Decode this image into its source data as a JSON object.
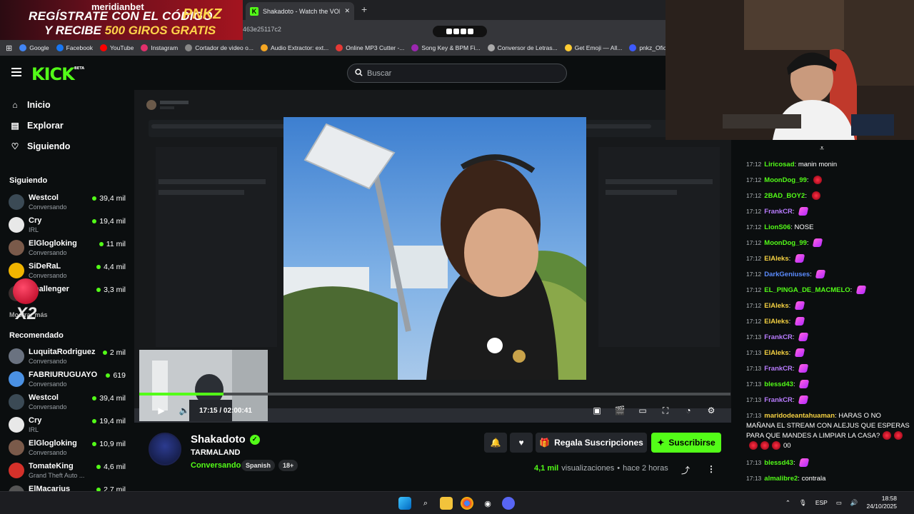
{
  "promo": {
    "brand": "meridianbet",
    "line1": "REGÍSTRATE CON EL CÓDIGO",
    "code": "PNKZ",
    "line2_prefix": "Y RECIBE ",
    "line2_highlight": "500 GIROS GRATIS"
  },
  "browser": {
    "tab_title": "Shakadoto - Watch the VOD on",
    "url_fragment": "463e25117c2",
    "bookmarks": [
      {
        "label": "Google",
        "color": "#4285f4"
      },
      {
        "label": "Facebook",
        "color": "#1877f2"
      },
      {
        "label": "YouTube",
        "color": "#ff0000"
      },
      {
        "label": "Instagram",
        "color": "#e1306c"
      },
      {
        "label": "Cortador de video o...",
        "color": "#888888"
      },
      {
        "label": "Audio Extractor: ext...",
        "color": "#f5a623"
      },
      {
        "label": "Online MP3 Cutter -...",
        "color": "#e53935"
      },
      {
        "label": "Song Key & BPM Fi...",
        "color": "#9c27b0"
      },
      {
        "label": "Conversor de Letras...",
        "color": "#aaaaaa"
      },
      {
        "label": "Get Emoji — All...",
        "color": "#ffcc33"
      },
      {
        "label": "pnkz_Ofic",
        "color": "#3d5afe"
      }
    ]
  },
  "kick": {
    "logo": "KICK",
    "logo_badge": "BETA",
    "search_placeholder": "Buscar"
  },
  "sidebar": {
    "nav": [
      "Inicio",
      "Explorar",
      "Siguiendo"
    ],
    "following_title": "Siguiendo",
    "following": [
      {
        "name": "Westcol",
        "sub": "Conversando",
        "viewers": "39,4 mil",
        "color": "#3b4a55"
      },
      {
        "name": "Cry",
        "sub": "IRL",
        "viewers": "19,4 mil",
        "color": "#e8e8e8"
      },
      {
        "name": "ElGlogloking",
        "sub": "Conversando",
        "viewers": "11 mil",
        "color": "#7a5a4a"
      },
      {
        "name": "SiDeRaL",
        "sub": "Conversando",
        "viewers": "4,4 mil",
        "color": "#f0b400"
      },
      {
        "name": "Challenger",
        "sub": "",
        "viewers": "3,3 mil",
        "color": "#3a2e2e"
      }
    ],
    "show_more": "Mostrar más",
    "recommended_title": "Recomendado",
    "recommended": [
      {
        "name": "LuquitaRodriguez",
        "sub": "Conversando",
        "viewers": "2 mil",
        "color": "#6a7280"
      },
      {
        "name": "FABRIURUGUAYO",
        "sub": "Conversando",
        "viewers": "619",
        "color": "#4a90e2"
      },
      {
        "name": "Westcol",
        "sub": "Conversando",
        "viewers": "39,4 mil",
        "color": "#3b4a55"
      },
      {
        "name": "Cry",
        "sub": "IRL",
        "viewers": "19,4 mil",
        "color": "#e8e8e8"
      },
      {
        "name": "ElGlogloking",
        "sub": "Conversando",
        "viewers": "10,9 mil",
        "color": "#7a5a4a"
      },
      {
        "name": "TomateKing",
        "sub": "Grand Theft Auto ...",
        "viewers": "4,6 mil",
        "color": "#d4312a"
      },
      {
        "name": "ElMacarius",
        "sub": "",
        "viewers": "2,7 mil",
        "color": "#555555"
      }
    ],
    "overlay_text": "X2"
  },
  "player": {
    "current_time": "17:15",
    "separator": "/",
    "duration": "02:00:41",
    "progress": 0.143
  },
  "channel": {
    "name": "Shakadoto",
    "title": "TARMALAND",
    "category": "Conversando",
    "tags": [
      "Spanish",
      "18+"
    ],
    "gift_label": "Regala Suscripciones",
    "subscribe_label": "Suscribirse",
    "views_count": "4,1 mil",
    "views_label": "visualizaciones",
    "ago": "hace 2 horas",
    "accent": "#53fc18"
  },
  "chat": {
    "messages": [
      {
        "time": "17:12",
        "user": "Liricosad",
        "color": "#53fc18",
        "text": "manin monin",
        "emotes": []
      },
      {
        "time": "17:12",
        "user": "MoonDog_99",
        "color": "#53fc18",
        "text": "",
        "emotes": [
          "red"
        ]
      },
      {
        "time": "17:12",
        "user": "2BAD_BOY2",
        "color": "#53fc18",
        "text": "",
        "emotes": [
          "red"
        ]
      },
      {
        "time": "17:12",
        "user": "FrankCR",
        "color": "#b97cff",
        "text": "",
        "emotes": [
          "hand"
        ]
      },
      {
        "time": "17:12",
        "user": "LionS06",
        "color": "#53fc18",
        "text": "NOSE",
        "emotes": []
      },
      {
        "time": "17:12",
        "user": "MoonDog_99",
        "color": "#53fc18",
        "text": "",
        "emotes": [
          "hand"
        ]
      },
      {
        "time": "17:12",
        "user": "ElAleks",
        "color": "#f5d142",
        "text": "",
        "emotes": [
          "hand"
        ]
      },
      {
        "time": "17:12",
        "user": "DarkGeniuses",
        "color": "#5b8cff",
        "text": "",
        "emotes": [
          "hand"
        ]
      },
      {
        "time": "17:12",
        "user": "EL_PINGA_DE_MACMELO",
        "color": "#53fc18",
        "text": "",
        "emotes": [
          "hand"
        ]
      },
      {
        "time": "17:12",
        "user": "ElAleks",
        "color": "#f5d142",
        "text": "",
        "emotes": [
          "hand"
        ]
      },
      {
        "time": "17:12",
        "user": "ElAleks",
        "color": "#f5d142",
        "text": "",
        "emotes": [
          "hand"
        ]
      },
      {
        "time": "17:13",
        "user": "FrankCR",
        "color": "#b97cff",
        "text": "",
        "emotes": [
          "hand"
        ]
      },
      {
        "time": "17:13",
        "user": "ElAleks",
        "color": "#f5d142",
        "text": "",
        "emotes": [
          "hand"
        ]
      },
      {
        "time": "17:13",
        "user": "FrankCR",
        "color": "#b97cff",
        "text": "",
        "emotes": [
          "hand"
        ]
      },
      {
        "time": "17:13",
        "user": "blessd43",
        "color": "#53fc18",
        "text": "",
        "emotes": [
          "hand"
        ]
      },
      {
        "time": "17:13",
        "user": "FrankCR",
        "color": "#b97cff",
        "text": "",
        "emotes": [
          "hand"
        ]
      },
      {
        "time": "17:13",
        "user": "maridodeantahuaman",
        "color": "#f5d142",
        "text": "HARAS O NO MAÑANA EL STREAM CON ALEJUS QUE ESPERAS PARA QUE MANDES A LIMPIAR LA CASA?",
        "emotes": [
          "red",
          "red",
          "red",
          "red",
          "red"
        ],
        "suffix": "00"
      },
      {
        "time": "17:13",
        "user": "blessd43",
        "color": "#53fc18",
        "text": "",
        "emotes": [
          "hand"
        ]
      },
      {
        "time": "17:13",
        "user": "almalibre2",
        "color": "#53fc18",
        "text": "contrala",
        "emotes": []
      }
    ]
  },
  "taskbar": {
    "lang": "ESP",
    "time": "18:58",
    "date": "24/10/2025"
  }
}
